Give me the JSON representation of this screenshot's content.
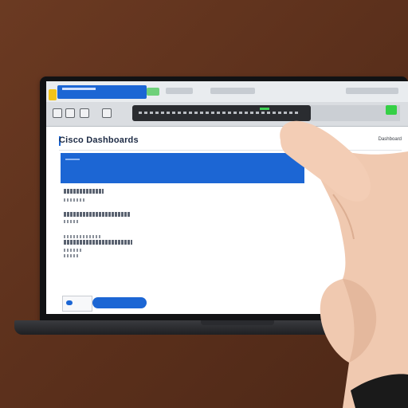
{
  "browser": {
    "active_tab_color": "#1c66d4",
    "accent_green": "#35d046",
    "favicon_color": "#f2c318",
    "toolbar_icons": [
      "back-icon",
      "forward-icon",
      "reload-icon",
      "home-icon"
    ]
  },
  "page": {
    "title": "Cisco Dashboards",
    "top_link": "Dashboard",
    "banner_color": "#1c66d4"
  },
  "scene": {
    "background_color": "#5f331e",
    "laptop_color": "#111214",
    "skin_color": "#f0c9b0",
    "sleeve_color": "#1a1a1a"
  }
}
